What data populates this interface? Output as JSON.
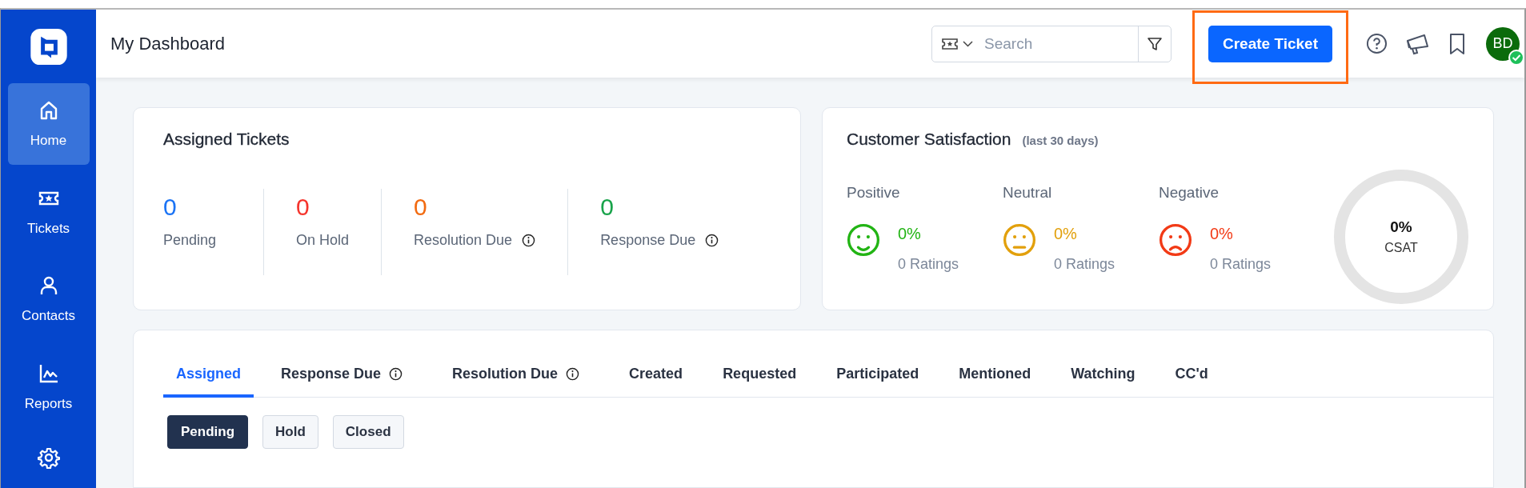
{
  "sidebar": {
    "items": [
      {
        "label": "Home",
        "selected": true
      },
      {
        "label": "Tickets",
        "selected": false
      },
      {
        "label": "Contacts",
        "selected": false
      },
      {
        "label": "Reports",
        "selected": false
      },
      {
        "selected": false
      }
    ]
  },
  "header": {
    "title": "My Dashboard",
    "search": {
      "placeholder": "Search"
    },
    "create_button": {
      "label": "Create Ticket",
      "highlighted": true
    },
    "avatar": {
      "initials": "BD",
      "online": true
    }
  },
  "assigned_tickets": {
    "title": "Assigned Tickets",
    "stats": [
      {
        "value": "0",
        "label": "Pending",
        "color": "#1a73f5",
        "info": false
      },
      {
        "value": "0",
        "label": "On Hold",
        "color": "#f5342c",
        "info": false
      },
      {
        "value": "0",
        "label": "Resolution Due",
        "color": "#f26a10",
        "info": true
      },
      {
        "value": "0",
        "label": "Response Due",
        "color": "#18a34a",
        "info": true
      }
    ]
  },
  "satisfaction": {
    "title": "Customer Satisfaction",
    "period": "(last 30 days)",
    "groups": [
      {
        "kind": "positive",
        "label": "Positive",
        "percent": "0%",
        "ratings": "0 Ratings",
        "color": "#22b414"
      },
      {
        "kind": "neutral",
        "label": "Neutral",
        "percent": "0%",
        "ratings": "0 Ratings",
        "color": "#e2a00c"
      },
      {
        "kind": "negative",
        "label": "Negative",
        "percent": "0%",
        "ratings": "0 Ratings",
        "color": "#f23a16"
      }
    ],
    "csat": {
      "value": "0%",
      "label": "CSAT"
    }
  },
  "ticket_tabs": [
    {
      "label": "Assigned",
      "info": false,
      "selected": true
    },
    {
      "label": "Response Due",
      "info": true,
      "selected": false
    },
    {
      "label": "Resolution Due",
      "info": true,
      "selected": false
    },
    {
      "label": "Created",
      "info": false,
      "selected": false
    },
    {
      "label": "Requested",
      "info": false,
      "selected": false
    },
    {
      "label": "Participated",
      "info": false,
      "selected": false
    },
    {
      "label": "Mentioned",
      "info": false,
      "selected": false
    },
    {
      "label": "Watching",
      "info": false,
      "selected": false
    },
    {
      "label": "CC'd",
      "info": false,
      "selected": false
    }
  ],
  "filters": [
    {
      "label": "Pending",
      "selected": true
    },
    {
      "label": "Hold",
      "selected": false
    },
    {
      "label": "Closed",
      "selected": false
    }
  ]
}
